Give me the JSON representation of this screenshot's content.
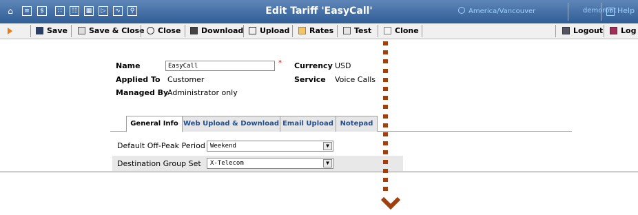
{
  "window": {
    "title": "Edit Tariff 'EasyCall'"
  },
  "nav": {
    "icons": [
      "home-icon",
      "list-icon",
      "dollar-icon",
      "grid-icon",
      "person-icon",
      "tree-icon",
      "forward-icon",
      "chart-icon",
      "search-icon"
    ],
    "timezone": "America/Vancouver",
    "user": "demoroot",
    "help": "Help"
  },
  "toolbar": {
    "save": "Save",
    "save_close": "Save & Close",
    "close": "Close",
    "download": "Download",
    "upload": "Upload",
    "rates": "Rates",
    "test": "Test",
    "clone": "Clone",
    "logout": "Logout",
    "log": "Log"
  },
  "form": {
    "name_label": "Name",
    "name_value": "EasyCall",
    "required_mark": "*",
    "applied_to_label": "Applied To",
    "applied_to_value": "Customer",
    "managed_by_label": "Managed By",
    "managed_by_value": "Administrator only",
    "currency_label": "Currency",
    "currency_value": "USD",
    "service_label": "Service",
    "service_value": "Voice Calls"
  },
  "tabs": [
    {
      "label": "General Info",
      "active": true
    },
    {
      "label": "Web Upload & Download",
      "active": false
    },
    {
      "label": "Email Upload",
      "active": false
    },
    {
      "label": "Notepad",
      "active": false
    }
  ],
  "general": {
    "offpeak_label": "Default Off-Peak Period",
    "offpeak_value": "Weekend",
    "destgroup_label": "Destination Group Set",
    "destgroup_value": "X-Telecom"
  },
  "colors": {
    "header": "#2f5d96",
    "accent_text": "#9fd1ff",
    "tab_link": "#1f4e94",
    "guide": "#a0400f",
    "toolbar_marker": "#ee7a10"
  }
}
